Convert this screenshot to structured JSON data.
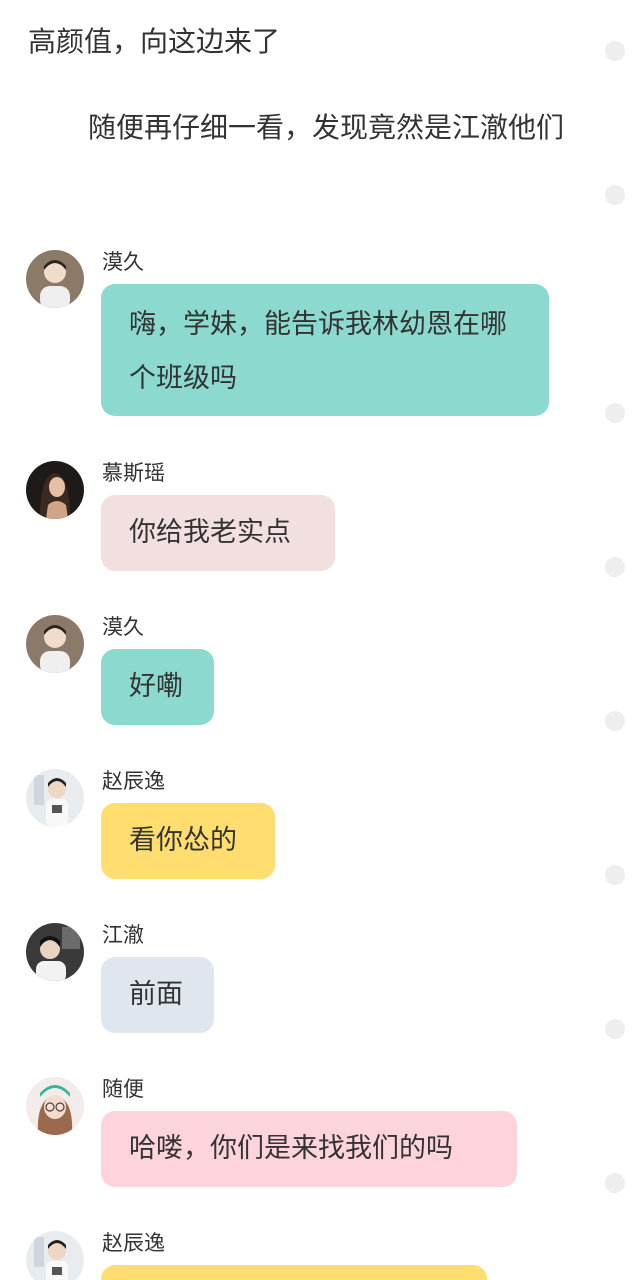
{
  "narration": [
    "高颜值，向这边来了",
    "随便再仔细一看，发现竟然是江澈他们"
  ],
  "messages": [
    {
      "speaker": "漠久",
      "text": "嗨，学妹，能告诉我林幼恩在哪个班级吗",
      "bubble_color": "#8bd9cf",
      "avatar_icon": "boy-avatar-icon"
    },
    {
      "speaker": "慕斯瑶",
      "text": "你给我老实点",
      "bubble_color": "#f2e0e0",
      "avatar_icon": "girl-avatar-icon"
    },
    {
      "speaker": "漠久",
      "text": "好嘞",
      "bubble_color": "#8bd9cf",
      "avatar_icon": "boy-avatar-icon"
    },
    {
      "speaker": "赵辰逸",
      "text": "看你怂的",
      "bubble_color": "#ffdd6e",
      "avatar_icon": "boy-avatar-icon"
    },
    {
      "speaker": "江澈",
      "text": "前面",
      "bubble_color": "#e0e6ee",
      "avatar_icon": "boy-avatar-icon"
    },
    {
      "speaker": "随便",
      "text": "哈喽，你们是来找我们的吗",
      "bubble_color": "#fdd3dc",
      "avatar_icon": "girl-avatar-icon"
    },
    {
      "speaker": "赵辰逸",
      "text": "",
      "bubble_color": "#ffdd6e",
      "avatar_icon": "boy-avatar-icon"
    }
  ]
}
